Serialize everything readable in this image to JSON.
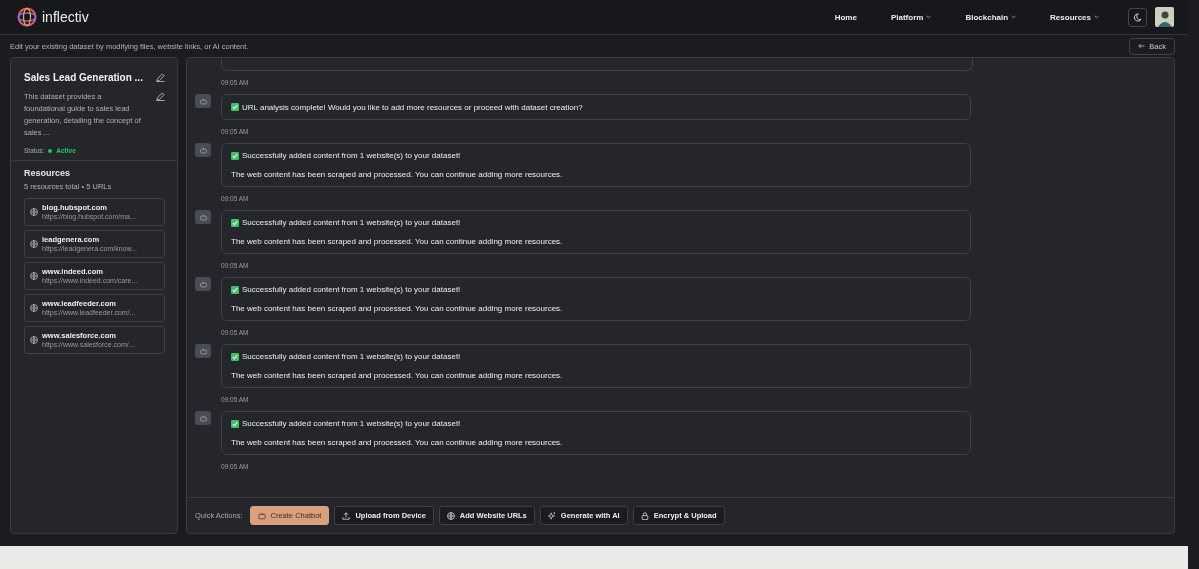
{
  "header": {
    "logo": "inflectiv",
    "nav": [
      {
        "label": "Home",
        "dropdown": false
      },
      {
        "label": "Platform",
        "dropdown": true
      },
      {
        "label": "Blockchain",
        "dropdown": true
      },
      {
        "label": "Resources",
        "dropdown": true
      }
    ]
  },
  "subtitle": "Edit your existing dataset by modifying files, website links, or AI content.",
  "back_button": "Back",
  "dataset": {
    "title": "Sales Lead Generation ...",
    "description": "This dataset provides a foundational guide to sales lead generation, detailing the concept of sales ...",
    "status_label": "Status:",
    "status": "Active",
    "active": true
  },
  "resources": {
    "title": "Resources",
    "summary": "5 resources total • 5 URLs",
    "items": [
      {
        "name": "blog.hubspot.com",
        "url": "https://blog.hubspot.com/ma..."
      },
      {
        "name": "leadgenera.com",
        "url": "https://leadgenera.com/know..."
      },
      {
        "name": "www.indeed.com",
        "url": "https://www.indeed.com/care..."
      },
      {
        "name": "www.leadfeeder.com",
        "url": "https://www.leadfeeder.com/..."
      },
      {
        "name": "www.salesforce.com",
        "url": "https://www.salesforce.com/..."
      }
    ]
  },
  "chat": {
    "first_time": "09:05 AM",
    "messages": [
      {
        "kind": "single",
        "title": "URL analysis complete! Would you like to add more resources or proceed with dataset creation?",
        "time": "09:05 AM"
      },
      {
        "kind": "double",
        "title": "Successfully added content from 1 website(s) to your dataset!",
        "body": "The web content has been scraped and processed. You can continue adding more resources.",
        "time": "09:05 AM"
      },
      {
        "kind": "double",
        "title": "Successfully added content from 1 website(s) to your dataset!",
        "body": "The web content has been scraped and processed. You can continue adding more resources.",
        "time": "09:05 AM"
      },
      {
        "kind": "double",
        "title": "Successfully added content from 1 website(s) to your dataset!",
        "body": "The web content has been scraped and processed. You can continue adding more resources.",
        "time": "09:05 AM"
      },
      {
        "kind": "double",
        "title": "Successfully added content from 1 website(s) to your dataset!",
        "body": "The web content has been scraped and processed. You can continue adding more resources.",
        "time": "09:05 AM"
      },
      {
        "kind": "double",
        "title": "Successfully added content from 1 website(s) to your dataset!",
        "body": "The web content has been scraped and processed. You can continue adding more resources.",
        "time": "09:05 AM"
      }
    ]
  },
  "quick_actions": {
    "label": "Quick Actions:",
    "buttons": [
      {
        "kind": "bot",
        "label": "Create Chatbot",
        "primary": true
      },
      {
        "kind": "upload",
        "label": "Upload from Device",
        "primary": false
      },
      {
        "kind": "globe",
        "label": "Add Website URLs",
        "primary": false
      },
      {
        "kind": "sparkle",
        "label": "Generate with AI",
        "primary": false
      },
      {
        "kind": "lock",
        "label": "Encrypt & Upload",
        "primary": false
      }
    ]
  }
}
